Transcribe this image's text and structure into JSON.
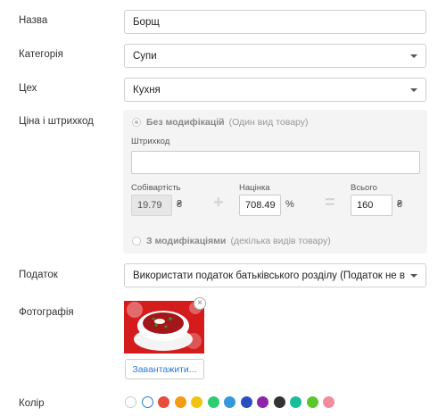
{
  "form": {
    "name_label": "Назва",
    "name_value": "Борщ",
    "category_label": "Категорія",
    "category_value": "Супи",
    "workshop_label": "Цех",
    "workshop_value": "Кухня",
    "price_label": "Ціна і штрихкод",
    "tax_label": "Податок",
    "tax_value": "Використати податок батьківського розділу (Податок не вказано)",
    "photo_label": "Фотографія",
    "upload_button": "Завантажити...",
    "color_label": "Колір"
  },
  "price_panel": {
    "no_mod_label": "Без модифікацій",
    "no_mod_hint": "(Один вид товару)",
    "barcode_label": "Штрихкод",
    "barcode_value": "",
    "cost_label": "Собівартість",
    "cost_value": "19.79",
    "currency": "₴",
    "plus": "+",
    "markup_label": "Націнка",
    "markup_value": "708.49",
    "percent": "%",
    "equals": "=",
    "total_label": "Всього",
    "total_value": "160",
    "with_mod_label": "З модифікаціями",
    "with_mod_hint": "(декілька видів товару)"
  },
  "photo": {
    "close_glyph": "×"
  },
  "colors": {
    "swatches": [
      "#ffffff",
      "#ffffff",
      "#e74c3c",
      "#f39c12",
      "#f1c40f",
      "#2ecc71",
      "#3498db",
      "#2c4fbf",
      "#8e24aa",
      "#333333",
      "#1abc9c",
      "#5ac82d",
      "#f28b9b"
    ],
    "selected_index": 1,
    "accent": "#2b7bd3"
  }
}
